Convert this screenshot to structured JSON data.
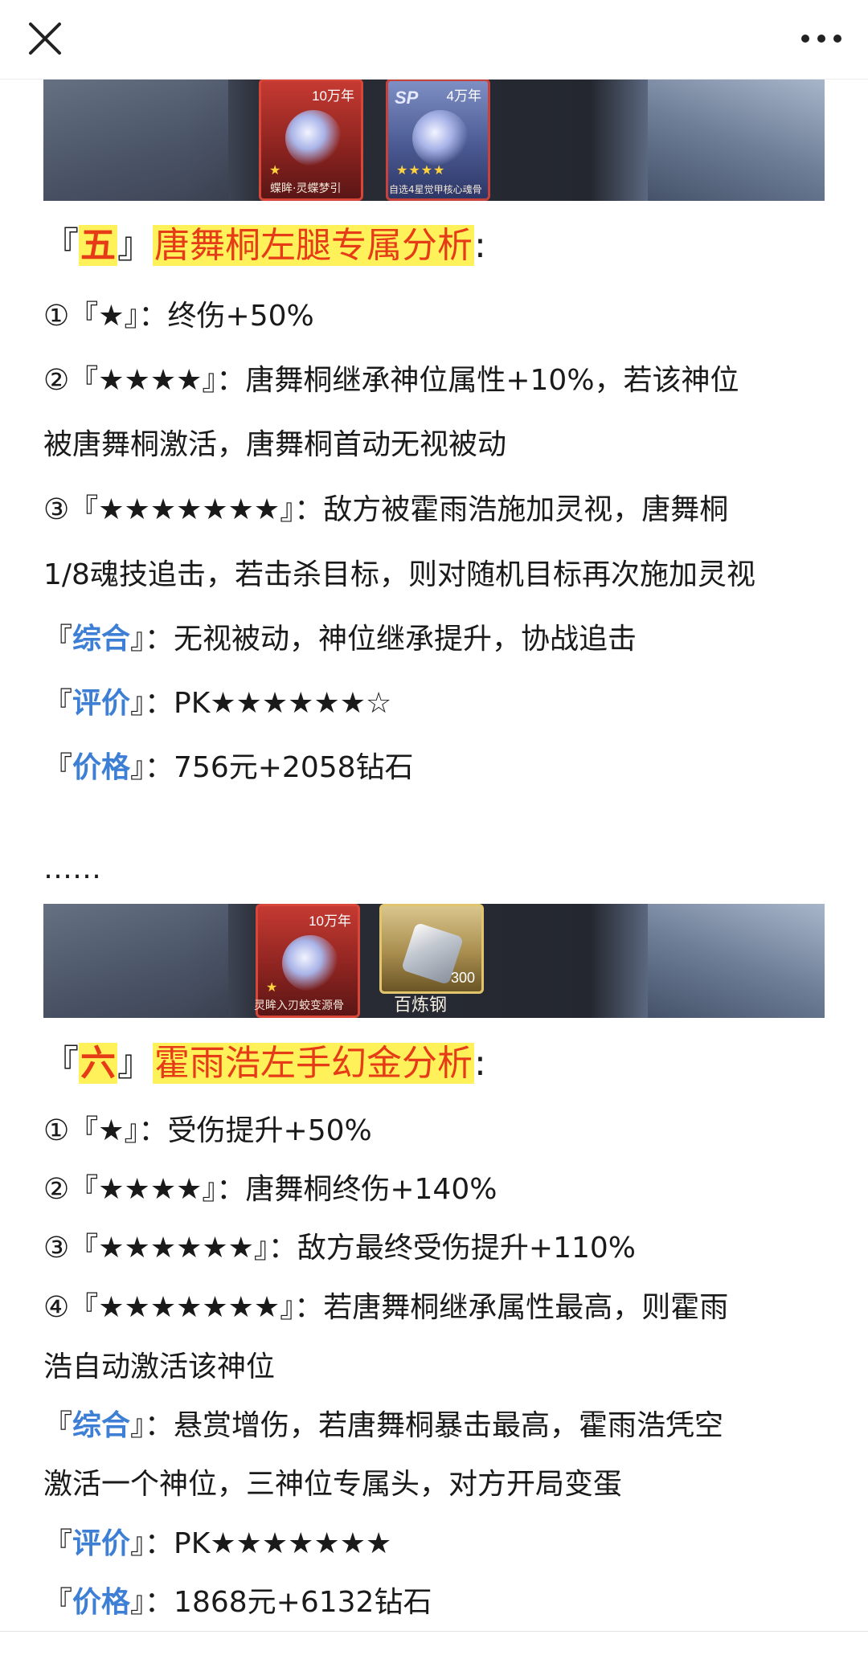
{
  "topbar": {
    "close_icon": "close-icon",
    "more_icon": "more-dots-icon"
  },
  "banner1": {
    "card1_tag": "10万年",
    "card1_stars": "★",
    "card1_caption": "蝶眸·灵蝶梦引",
    "card2_sp": "SP",
    "card2_tag": "4万年",
    "card2_stars": "★★★★",
    "card2_caption": "自选4星觉甲核心魂骨"
  },
  "section5": {
    "title_open": "『",
    "title_num": "五",
    "title_close": "』",
    "title_text": "唐舞桐左腿专属分析",
    "title_colon": ":",
    "line1": "①『★』：终伤+50%",
    "line2a": "②『★★★★』：唐舞桐继承神位属性+10%，若该神位",
    "line2b": "被唐舞桐激活，唐舞桐首动无视被动",
    "line3a": "③『★★★★★★★』：敌方被霍雨浩施加灵视，唐舞桐",
    "line3b": "1/8魂技追击，若击杀目标，则对随机目标再次施加灵视",
    "summary_label": "综合",
    "summary_text": "无视被动，神位继承提升，协战追击",
    "rating_label": "评价",
    "rating_text": "PK★★★★★★☆",
    "price_label": "价格",
    "price_text": "756元+2058钻石"
  },
  "ellipsis": "……",
  "banner2": {
    "card1_tag": "10万年",
    "card1_stars": "★",
    "card1_caption": "灵眸入刃蛟变源骨",
    "card2_qty": "300",
    "card2_caption": "百炼钢"
  },
  "section6": {
    "title_open": "『",
    "title_num": "六",
    "title_close": "』",
    "title_text": "霍雨浩左手幻金分析",
    "title_colon": ":",
    "line1": "①『★』：受伤提升+50%",
    "line2": "②『★★★★』：唐舞桐终伤+140%",
    "line3": "③『★★★★★★』：敌方最终受伤提升+110%",
    "line4a": "④『★★★★★★★』：若唐舞桐继承属性最高，则霍雨",
    "line4b": "浩自动激活该神位",
    "summary_label": "综合",
    "summary_text_a": "悬赏增伤，若唐舞桐暴击最高，霍雨浩凭空",
    "summary_text_b": "激活一个神位，三神位专属头，对方开局变蛋",
    "rating_label": "评价",
    "rating_text": "PK★★★★★★★",
    "price_label": "价格",
    "price_text": "1868元+6132钻石"
  },
  "brackets": {
    "open": "『",
    "close": "』："
  },
  "colors": {
    "highlight_bg": "#fff15a",
    "highlight_text": "#e53c17",
    "label_blue": "#3e7fd6"
  }
}
